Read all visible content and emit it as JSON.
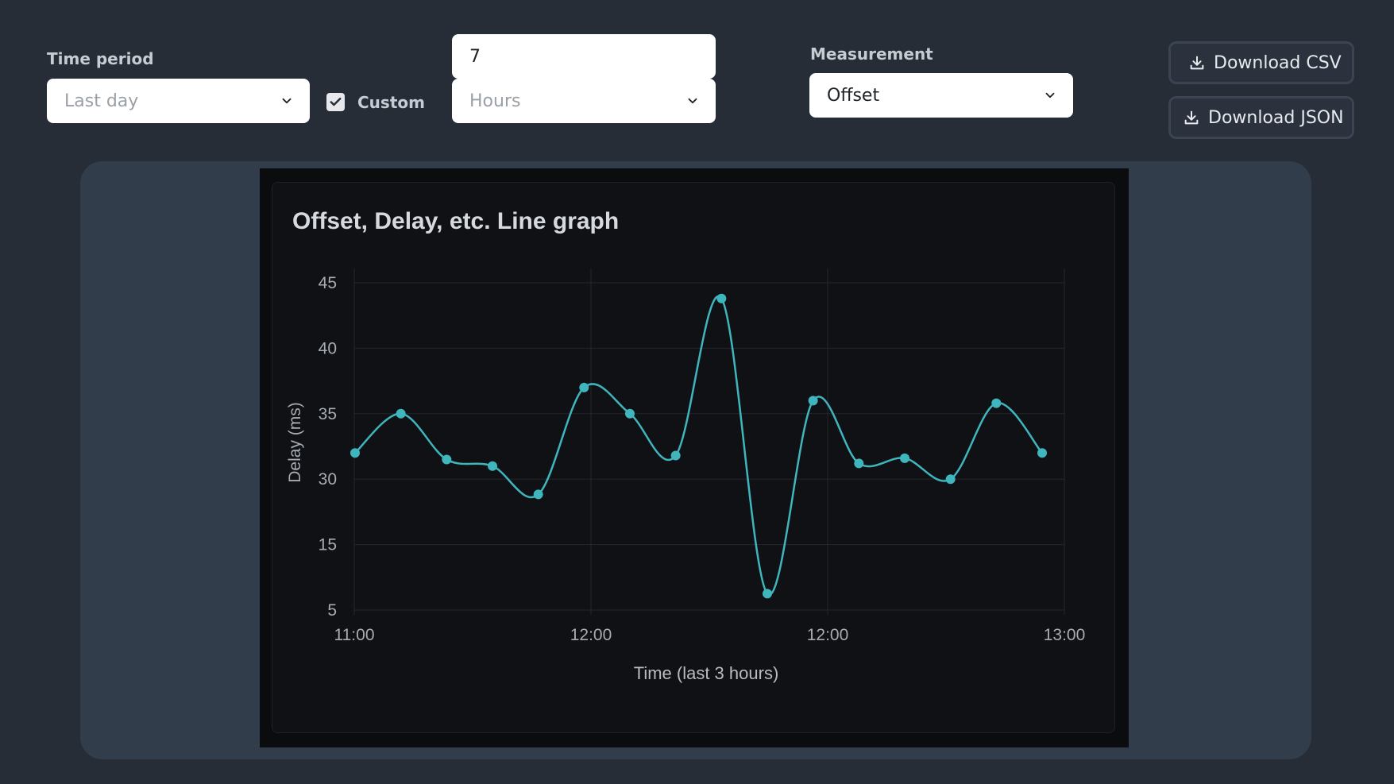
{
  "controls": {
    "time_period_label": "Time period",
    "time_period_value": "Last day",
    "custom_label": "Custom",
    "custom_checked": true,
    "custom_amount_value": "7",
    "custom_unit_value": "Hours",
    "measurement_label": "Measurement",
    "measurement_value": "Offset",
    "download_csv_label": "Download CSV",
    "download_json_label": "Download JSON"
  },
  "icons": {
    "dropdown": "chevron-down-icon",
    "download": "download-icon",
    "checkbox": "check-icon"
  },
  "colors": {
    "line": "#3fb6bd",
    "background": "#272d37",
    "panel": "#323d4c"
  },
  "chart_data": {
    "type": "line",
    "title": "Offset, Delay, etc. Line graph",
    "xlabel": "Time (last 3 hours)",
    "ylabel": "Delay (ms)",
    "y_ticks": [
      "45",
      "40",
      "35",
      "30",
      "15",
      "5"
    ],
    "x_ticks": [
      "11:00",
      "12:00",
      "12:00",
      "13:00"
    ],
    "ylim": [
      5,
      45
    ],
    "grid": true,
    "series": [
      {
        "values": [
          32,
          35,
          31.5,
          31,
          26.5,
          37,
          35,
          31.8,
          43.8,
          7.5,
          36,
          31.2,
          31.6,
          30,
          35.8,
          32
        ]
      }
    ]
  }
}
